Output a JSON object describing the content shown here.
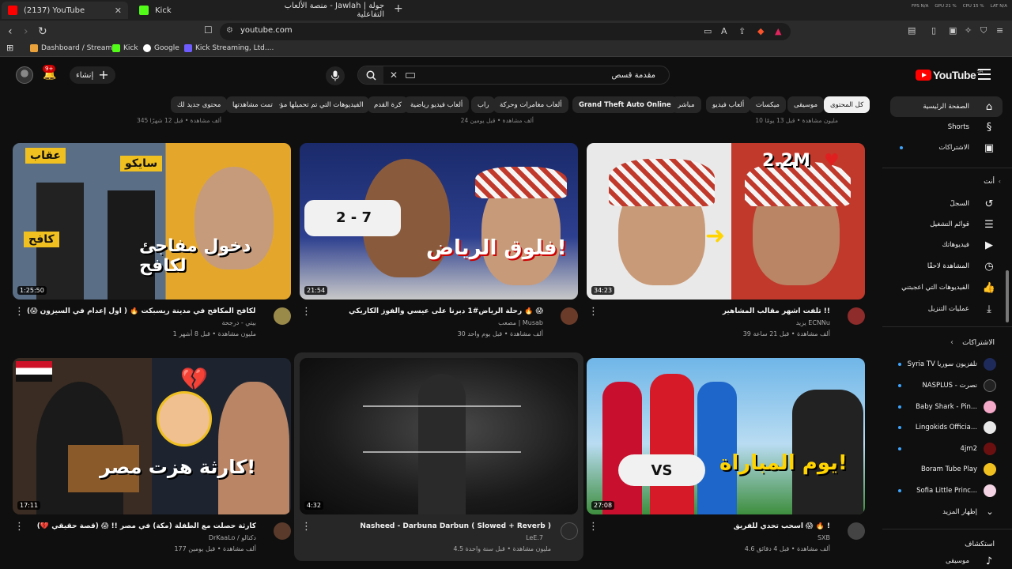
{
  "browser": {
    "tabs": [
      {
        "title": "(2137) YouTube",
        "active": true
      },
      {
        "title": "Kick",
        "active": false
      },
      {
        "title": "جولة | Jawlah - منصة الألعاب التفاعلية",
        "active": false
      }
    ],
    "url": "youtube.com",
    "perf": [
      "FPS N/A",
      "GPU 21 %",
      "CPU 15 %",
      "LAT N/A"
    ],
    "bookmarks": [
      "Dashboard / Stream...",
      "Kick",
      "Google",
      "Kick Streaming, Ltd...."
    ]
  },
  "header": {
    "logo": "YouTube",
    "region": "SA",
    "search_value": "مقدمة قسص",
    "create_label": "إنشاء",
    "notification_count": "9+"
  },
  "chips": [
    "كل المحتوى",
    "موسيقى",
    "ميكسات",
    "ألعاب فيديو",
    "مباشر",
    "Grand Theft Auto Online",
    "ألعاب مغامرات وحركة",
    "راب",
    "ألعاب فيديو رياضية",
    "كرة القدم",
    "الفيديوهات التي تم تحميلها مؤخرًا",
    "تمت مشاهدتها",
    "محتوى جديد لك"
  ],
  "sidebar": {
    "main": [
      "الصفحة الرئيسية",
      "Shorts",
      "الاشتراكات"
    ],
    "you_header": "أنت",
    "you_items": [
      "السجلّ",
      "قوائم التشغيل",
      "فيديوهاتك",
      "المشاهدة لاحقًا",
      "الفيديوهات التي أعجبتني",
      "عمليات التنزيل"
    ],
    "subs_header": "الاشتراكات",
    "subs": [
      "Syria TV تلفزيون سوريا",
      "NASPLUS - نصرت",
      "Baby Shark - Pin...",
      "Lingokids Officia...",
      "4jm2",
      "Boram Tube Play",
      "Sofia Little Princ..."
    ],
    "show_more": "إظهار المزيد",
    "explore_header": "استكشاف",
    "explore_items": [
      "موسيقى"
    ]
  },
  "top_meta": [
    "345 ألف مشاهدة • قبل 12 شهرًا",
    "24 ألف مشاهدة • قبل يومين",
    "10 مليون مشاهدة • قبل 13 يومًا"
  ],
  "videos": [
    {
      "title": "تلفت اشهر مقالب المشاهير !!",
      "channel": "يزيد ECNNu",
      "meta": "39 ألف مشاهدة • قبل 21 ساعة",
      "duration": "34:23",
      "overlay": "2.2M"
    },
    {
      "title": "رحلة الرياض#1 دبرنا على عيسي والفوز الكاريكي 🔥 😱",
      "channel": "مصعب | Musab",
      "meta": "30 ألف مشاهدة • قبل يوم واحد",
      "duration": "21:54",
      "overlay": "فلوق الرياض!"
    },
    {
      "title": "دخول مفاجئ لكافح المكافح في مدينة ريسبكت 🔥 ( اول إعدام في السيزون 😱)!!",
      "channel": "بيتي - درجحة",
      "meta": "1 مليون مشاهدة • قبل 8 أشهر",
      "duration": "1:25:50",
      "overlay": "دخول مفاجئ لكافح"
    },
    {
      "title": "اسحب تحدي للفريق 😱 🔥 !",
      "channel": "SXB",
      "meta": "4.6 ألف مشاهدة • قبل 4 دقائق",
      "duration": "27:08",
      "overlay": "يوم المباراة!"
    },
    {
      "title": "Nasheed - Darbuna Darbun ( Slowed + Reverb )",
      "channel": "LeE.7",
      "meta": "4.5 مليون مشاهدة • قبل سنة واحدة",
      "duration": "4:32",
      "overlay": ""
    },
    {
      "title": "كارثة حصلت مع الطفلة (مكة) في مصر !! 😱 (قصة حقيقي 💔)",
      "channel": "DrKaaLo / دكتالو",
      "meta": "177 ألف مشاهدة • قبل يومين",
      "duration": "17:11",
      "overlay": "كارثة هزت مصر!"
    }
  ],
  "colors": {
    "bg": "#0f0f0f",
    "chip": "#272727",
    "accent": "#ff0000",
    "text_secondary": "#aaaaaa"
  }
}
